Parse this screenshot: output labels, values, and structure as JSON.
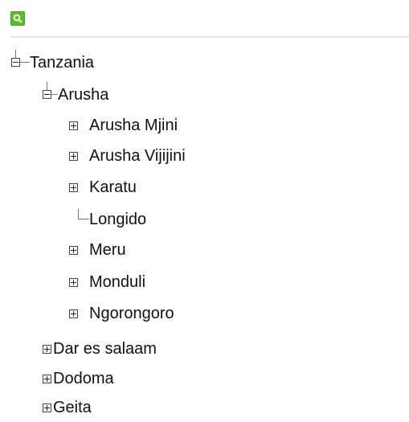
{
  "toolbar": {
    "search_icon": "search-icon",
    "accent": "#5cbf2a"
  },
  "tree": {
    "root": {
      "label": "Tanzania",
      "expanded": true
    },
    "regions": [
      {
        "label": "Arusha",
        "expanded": true,
        "districts": [
          {
            "label": "Arusha Mjini",
            "expandable": true
          },
          {
            "label": "Arusha Vijijini",
            "expandable": true
          },
          {
            "label": "Karatu",
            "expandable": true
          },
          {
            "label": "Longido",
            "expandable": false
          },
          {
            "label": "Meru",
            "expandable": true
          },
          {
            "label": "Monduli",
            "expandable": true
          },
          {
            "label": "Ngorongoro",
            "expandable": true
          }
        ]
      },
      {
        "label": "Dar es salaam",
        "expanded": false
      },
      {
        "label": "Dodoma",
        "expanded": false
      },
      {
        "label": "Geita",
        "expanded": false
      }
    ]
  }
}
